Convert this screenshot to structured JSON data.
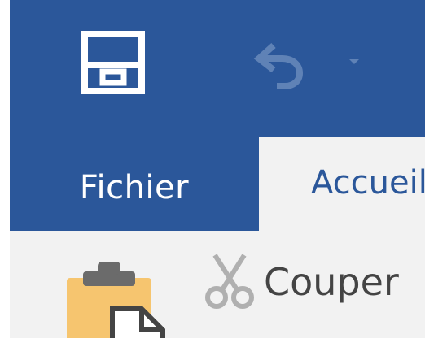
{
  "quick_access_toolbar": {
    "save_icon": "save-icon",
    "undo_icon": "undo-icon",
    "undo_dropdown_icon": "chevron-down-icon"
  },
  "tabs": {
    "file_label": "Fichier",
    "home_label": "Accueil"
  },
  "ribbon": {
    "paste_icon": "paste-icon",
    "cut_icon": "scissors-icon",
    "cut_label": "Couper"
  },
  "colors": {
    "accent": "#2b579a",
    "ribbon_bg": "#f2f2f2",
    "clipboard_body": "#f6c56f",
    "clipboard_clip": "#6b6b6b"
  }
}
